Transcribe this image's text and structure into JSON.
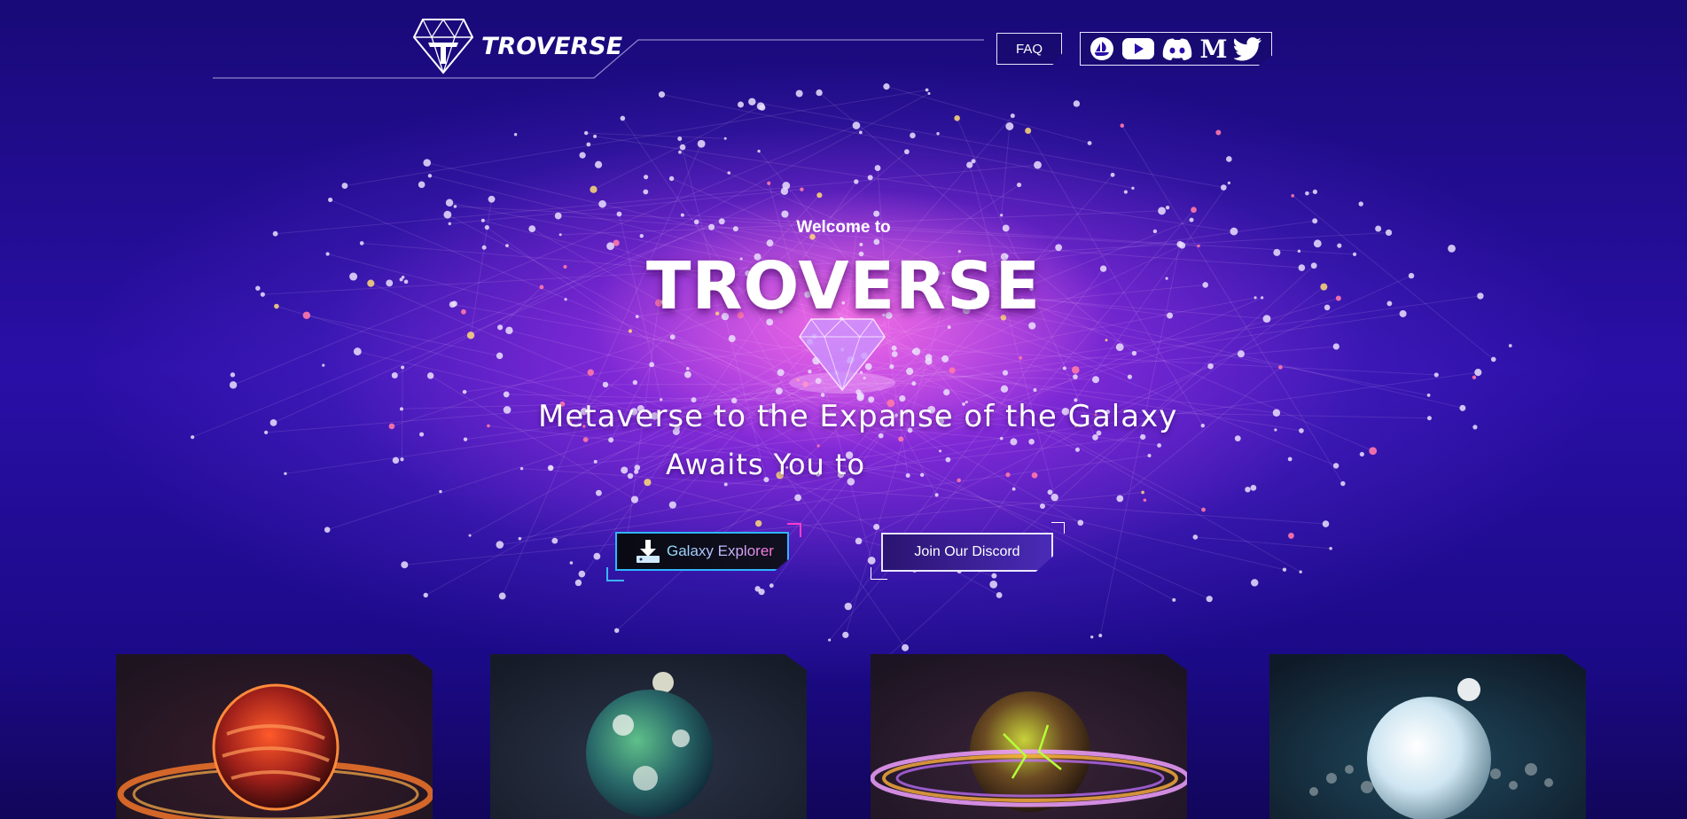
{
  "header": {
    "logo_text": "TROVERSE",
    "faq_label": "FAQ",
    "social_icons": [
      "opensea-icon",
      "youtube-icon",
      "discord-icon",
      "medium-icon",
      "twitter-icon"
    ],
    "medium_glyph": "M"
  },
  "hero": {
    "welcome": "Welcome to",
    "title": "TROVERSE",
    "tagline_line1": "Metaverse to the Expanse of the Galaxy",
    "tagline_line2": "Awaits You to"
  },
  "buttons": {
    "explorer_label": "Galaxy Explorer",
    "discord_label": "Join Our Discord"
  },
  "cards": [
    {
      "name": "lava-planet-card",
      "accent": "#ff6a1a"
    },
    {
      "name": "earth-planet-card",
      "accent": "#3fa06a"
    },
    {
      "name": "toxic-planet-card",
      "accent": "#b6d23a"
    },
    {
      "name": "ice-planet-card",
      "accent": "#cfe6f2"
    }
  ],
  "colors": {
    "background": "#2a0fa6",
    "nebula": "#d84be8",
    "explorer_border": "#2fb6ff",
    "explorer_corner": "#ff3ad0"
  }
}
